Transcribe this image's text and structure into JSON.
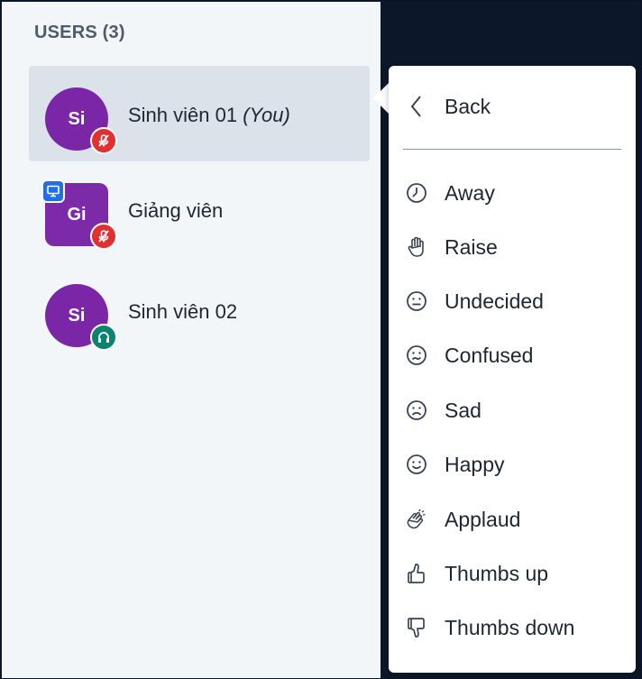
{
  "users_panel": {
    "title": "USERS (3)",
    "users": [
      {
        "initials": "Si",
        "name": "Sinh viên 01",
        "you_suffix": "(You)",
        "status": "muted"
      },
      {
        "initials": "Gi",
        "name": "Giảng viên",
        "status": "muted",
        "is_presenter": true
      },
      {
        "initials": "Si",
        "name": "Sinh viên 02",
        "status": "listen-only"
      }
    ]
  },
  "status_menu": {
    "back_label": "Back",
    "items": [
      {
        "label": "Away",
        "icon": "clock-icon"
      },
      {
        "label": "Raise",
        "icon": "hand-icon"
      },
      {
        "label": "Undecided",
        "icon": "undecided-face-icon"
      },
      {
        "label": "Confused",
        "icon": "confused-face-icon"
      },
      {
        "label": "Sad",
        "icon": "sad-face-icon"
      },
      {
        "label": "Happy",
        "icon": "happy-face-icon"
      },
      {
        "label": "Applaud",
        "icon": "applaud-icon"
      },
      {
        "label": "Thumbs up",
        "icon": "thumbs-up-icon"
      },
      {
        "label": "Thumbs down",
        "icon": "thumbs-down-icon"
      }
    ]
  },
  "colors": {
    "avatar_purple": "#7a26a7",
    "muted_red": "#e03131",
    "listen_teal": "#0d8271",
    "presenter_blue": "#1f6fe5",
    "selected_row": "#dbe2ea"
  }
}
